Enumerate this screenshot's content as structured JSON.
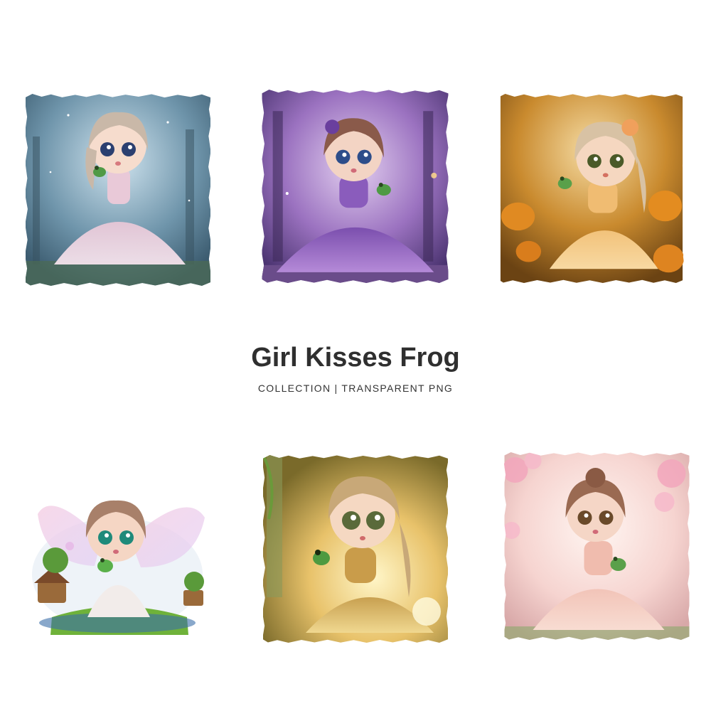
{
  "header": {
    "title": "Girl Kisses Frog",
    "subtitle": "COLLECTION | TRANSPARENT PNG"
  },
  "colors": {
    "title": "#2f2f2f",
    "subtitle": "#333333",
    "background": "#ffffff"
  },
  "gallery": {
    "items": [
      {
        "icon": "girl-frog-blue-forest-illustration"
      },
      {
        "icon": "girl-frog-purple-forest-illustration"
      },
      {
        "icon": "girl-frog-pumpkin-patch-illustration"
      },
      {
        "icon": "fairy-girl-frog-meadow-illustration"
      },
      {
        "icon": "girl-frog-golden-light-illustration"
      },
      {
        "icon": "girl-frog-cherry-blossom-illustration"
      }
    ]
  }
}
